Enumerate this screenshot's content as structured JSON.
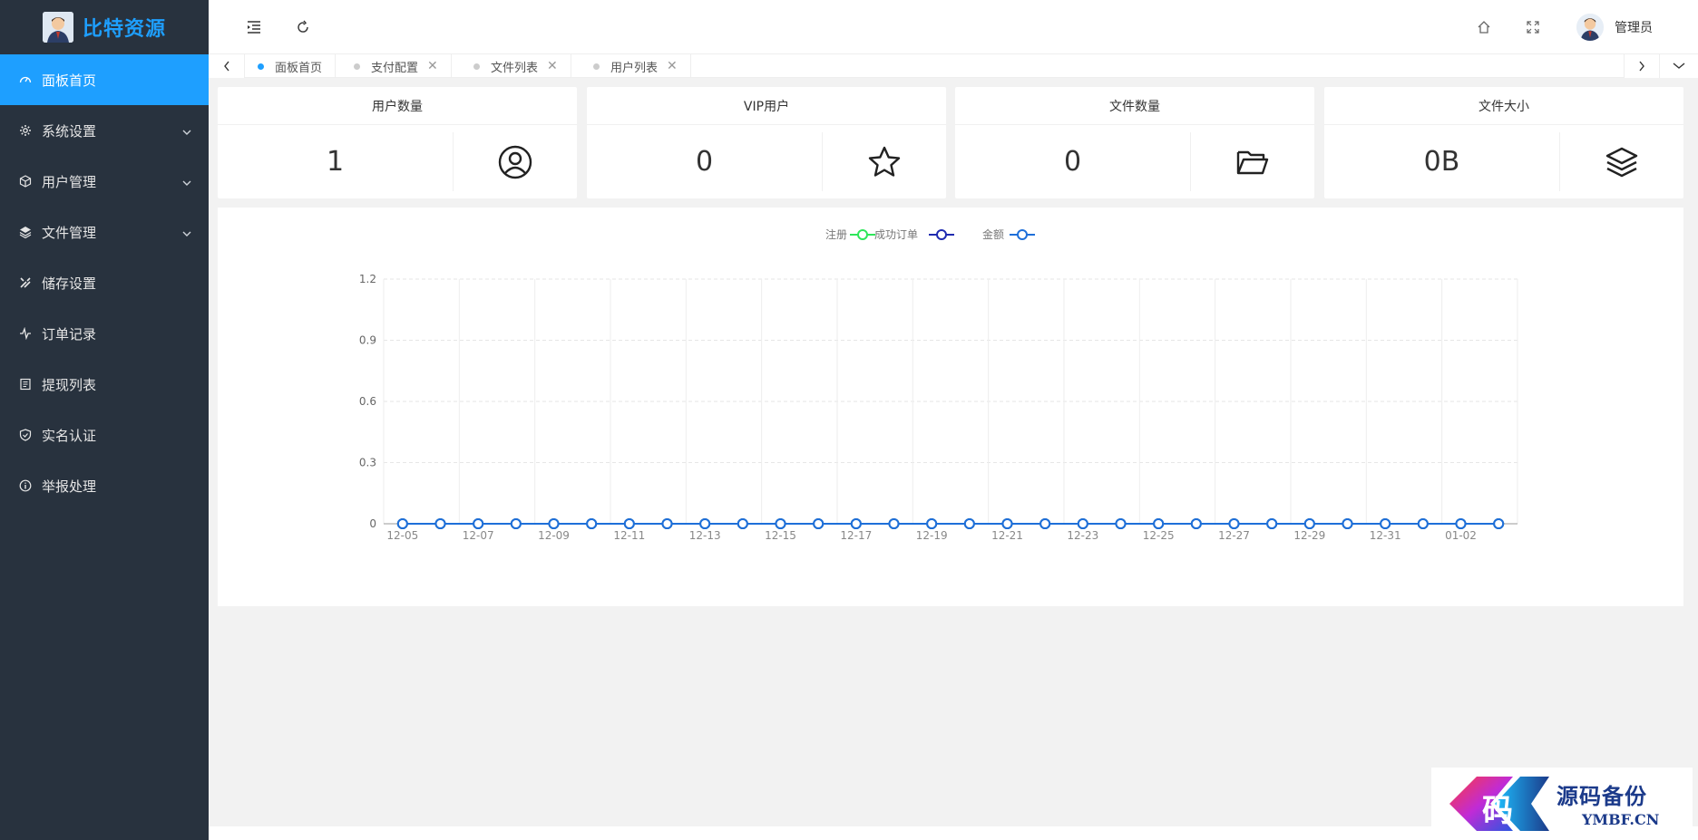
{
  "app": {
    "title": "比特资源"
  },
  "sidebar": {
    "items": [
      {
        "label": "面板首页",
        "icon": "dashboard-icon",
        "active": true,
        "has_children": false
      },
      {
        "label": "系统设置",
        "icon": "gear-icon",
        "active": false,
        "has_children": true
      },
      {
        "label": "用户管理",
        "icon": "cube-icon",
        "active": false,
        "has_children": true
      },
      {
        "label": "文件管理",
        "icon": "layers-icon",
        "active": false,
        "has_children": true
      },
      {
        "label": "储存设置",
        "icon": "tools-icon",
        "active": false,
        "has_children": false
      },
      {
        "label": "订单记录",
        "icon": "pulse-icon",
        "active": false,
        "has_children": false
      },
      {
        "label": "提现列表",
        "icon": "list-icon",
        "active": false,
        "has_children": false
      },
      {
        "label": "实名认证",
        "icon": "shield-check-icon",
        "active": false,
        "has_children": false
      },
      {
        "label": "举报处理",
        "icon": "info-icon",
        "active": false,
        "has_children": false
      }
    ]
  },
  "header": {
    "user_name": "管理员"
  },
  "tabs": [
    {
      "label": "面板首页",
      "active": true,
      "closable": false
    },
    {
      "label": "支付配置",
      "active": false,
      "closable": true
    },
    {
      "label": "文件列表",
      "active": false,
      "closable": true
    },
    {
      "label": "用户列表",
      "active": false,
      "closable": true
    }
  ],
  "stats": [
    {
      "title": "用户数量",
      "value": "1",
      "icon": "user-circle-icon"
    },
    {
      "title": "VIP用户",
      "value": "0",
      "icon": "star-icon"
    },
    {
      "title": "文件数量",
      "value": "0",
      "icon": "folder-open-icon"
    },
    {
      "title": "文件大小",
      "value": "0B",
      "icon": "layers-icon"
    }
  ],
  "chart_data": {
    "type": "line",
    "legend_position": "top-center",
    "grid": true,
    "ylim": [
      0,
      1.2
    ],
    "yticks": [
      "0",
      "0.3",
      "0.6",
      "0.9",
      "1.2"
    ],
    "x": [
      "12-05",
      "12-06",
      "12-07",
      "12-08",
      "12-09",
      "12-10",
      "12-11",
      "12-12",
      "12-13",
      "12-14",
      "12-15",
      "12-16",
      "12-17",
      "12-18",
      "12-19",
      "12-20",
      "12-21",
      "12-22",
      "12-23",
      "12-24",
      "12-25",
      "12-26",
      "12-27",
      "12-28",
      "12-29",
      "12-30",
      "12-31",
      "01-01",
      "01-02",
      "01-03"
    ],
    "xtick_labels": [
      "12-05",
      "12-07",
      "12-09",
      "12-11",
      "12-13",
      "12-15",
      "12-17",
      "12-19",
      "12-21",
      "12-23",
      "12-25",
      "12-27",
      "12-29",
      "12-31",
      "01-02"
    ],
    "series": [
      {
        "name": "注册",
        "color": "#2ee65a",
        "values": [
          0,
          0,
          0,
          0,
          0,
          0,
          0,
          0,
          0,
          0,
          0,
          0,
          0,
          0,
          0,
          0,
          0,
          0,
          0,
          0,
          0,
          0,
          0,
          0,
          0,
          0,
          0,
          0,
          0,
          0
        ]
      },
      {
        "name": "成功订单",
        "color": "#1f2bb0",
        "values": [
          0,
          0,
          0,
          0,
          0,
          0,
          0,
          0,
          0,
          0,
          0,
          0,
          0,
          0,
          0,
          0,
          0,
          0,
          0,
          0,
          0,
          0,
          0,
          0,
          0,
          0,
          0,
          0,
          0,
          0
        ]
      },
      {
        "name": "金额",
        "color": "#1e6fd9",
        "values": [
          0,
          0,
          0,
          0,
          0,
          0,
          0,
          0,
          0,
          0,
          0,
          0,
          0,
          0,
          0,
          0,
          0,
          0,
          0,
          0,
          0,
          0,
          0,
          0,
          0,
          0,
          0,
          0,
          0,
          0
        ]
      }
    ]
  },
  "watermark": {
    "text_cn": "源码备份",
    "text_en": "YMBF.CN",
    "glyph": "码"
  }
}
